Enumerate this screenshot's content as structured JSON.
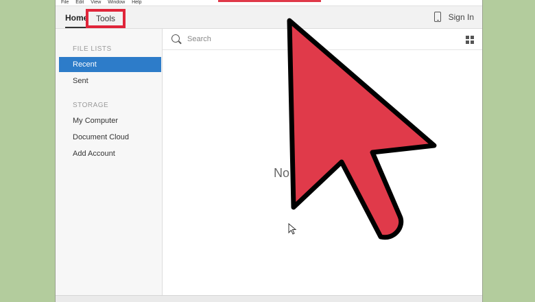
{
  "menubar": {
    "items": [
      "File",
      "Edit",
      "View",
      "Window",
      "Help"
    ]
  },
  "tabs": {
    "home": "Home",
    "tools": "Tools"
  },
  "header": {
    "sign_in": "Sign In",
    "phone_icon": "phone-icon"
  },
  "search": {
    "placeholder": "Search",
    "view_icon": "grid-icon"
  },
  "sidebar": {
    "file_lists_title": "FILE LISTS",
    "file_lists": [
      {
        "label": "Recent",
        "active": true
      },
      {
        "label": "Sent",
        "active": false
      }
    ],
    "storage_title": "STORAGE",
    "storage": [
      {
        "label": "My Computer"
      },
      {
        "label": "Document Cloud"
      },
      {
        "label": "Add Account"
      }
    ]
  },
  "main": {
    "empty_text": "No recent"
  },
  "colors": {
    "highlight_red": "#e0253a",
    "arrow_red": "#e03a4a",
    "active_blue": "#2d7cc9",
    "background_green": "#b3cc9d"
  }
}
